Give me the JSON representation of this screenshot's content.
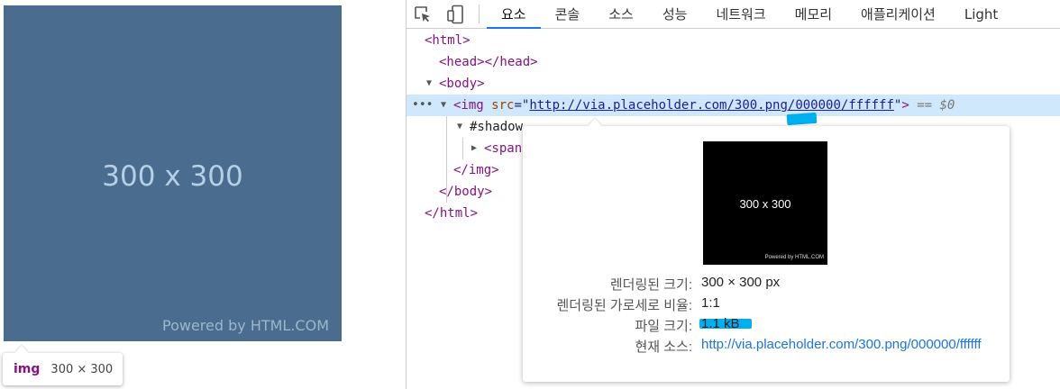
{
  "viewport": {
    "placeholder_text": "300 x 300",
    "powered_text": "Powered by HTML.COM",
    "tooltip": {
      "tag": "img",
      "dims": "300 × 300"
    }
  },
  "toolbar": {
    "tabs": [
      "요소",
      "콘솔",
      "소스",
      "성능",
      "네트워크",
      "메모리",
      "애플리케이션",
      "Light"
    ],
    "active_tab": "요소"
  },
  "tree": {
    "html_open": "<html>",
    "head": "<head></head>",
    "body_open": "<body>",
    "img_tag_open": "<img",
    "img_attr": "src",
    "img_src": "http://via.placeholder.com/300.png/000000/ffffff",
    "img_tag_close": ">",
    "dollar": "== $0",
    "shadow_root": "#shadow",
    "shadow_rest": "(",
    "shadow_close": ")",
    "span": "<span",
    "img_close": "</img>",
    "body_close": "</body>",
    "html_close": "</html>"
  },
  "popover": {
    "preview_text": "300 x 300",
    "preview_powered": "Powered by HTML.COM",
    "rows": [
      {
        "label": "렌더링된 크기:",
        "value": "300 × 300 px"
      },
      {
        "label": "렌더링된 가로세로 비율:",
        "value": "1:1"
      },
      {
        "label": "파일 크기:",
        "value": "1.1 kB"
      },
      {
        "label": "현재 소스:",
        "value": "http://via.placeholder.com/300.png/000000/ffffff"
      }
    ]
  },
  "colors": {
    "placeholder_bg": "#4a6d8f",
    "selected_row": "#cfe8fc",
    "tag": "#881280",
    "highlight": "#00aff0"
  }
}
